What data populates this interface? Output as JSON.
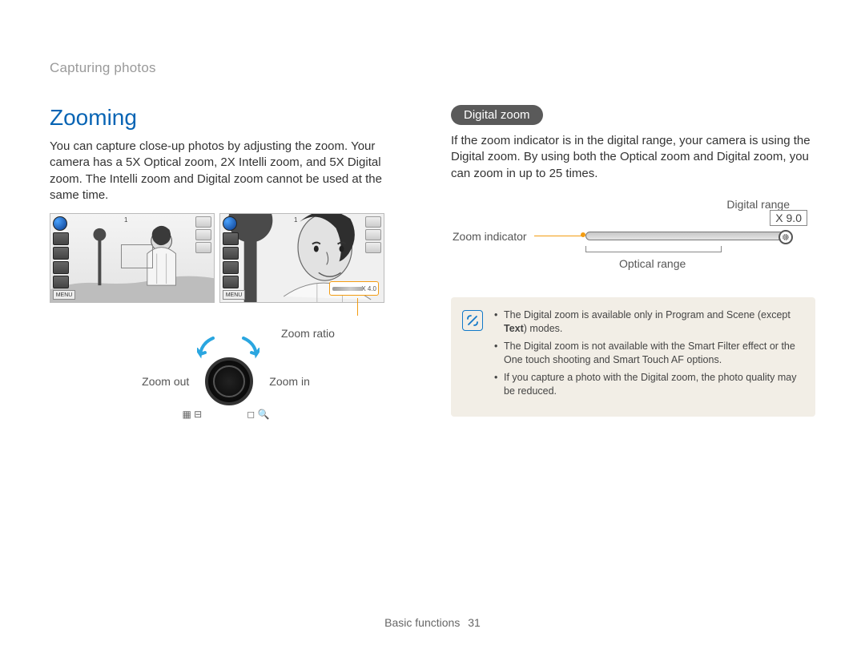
{
  "breadcrumb": "Capturing photos",
  "heading": "Zooming",
  "intro": "You can capture close-up photos by adjusting the zoom. Your camera has a 5X Optical zoom, 2X Intelli zoom, and 5X Digital zoom. The Intelli zoom and Digital zoom cannot be used at the same time.",
  "screenshots": {
    "menu_label": "MENU",
    "zoom_ratio_value": "X 4.0",
    "top_count": "1"
  },
  "left_labels": {
    "zoom_ratio": "Zoom ratio",
    "zoom_out": "Zoom out",
    "zoom_in": "Zoom in"
  },
  "right": {
    "pill": "Digital zoom",
    "body": "If the zoom indicator is in the digital range, your camera is using the Digital zoom. By using both the Optical zoom and Digital zoom, you can zoom in up to 25 times.",
    "digital_range": "Digital range",
    "zoom_indicator": "Zoom indicator",
    "optical_range": "Optical range",
    "zoom_value": "X 9.0"
  },
  "notes": {
    "items": [
      {
        "pre": "The Digital zoom is available only in Program and Scene (except ",
        "bold": "Text",
        "post": ") modes."
      },
      {
        "pre": "The Digital zoom is not available with the Smart Filter effect or the One touch shooting and Smart Touch AF options.",
        "bold": "",
        "post": ""
      },
      {
        "pre": "If you capture a photo with the Digital zoom, the photo quality may be reduced.",
        "bold": "",
        "post": ""
      }
    ]
  },
  "footer": {
    "section": "Basic functions",
    "page": "31"
  }
}
